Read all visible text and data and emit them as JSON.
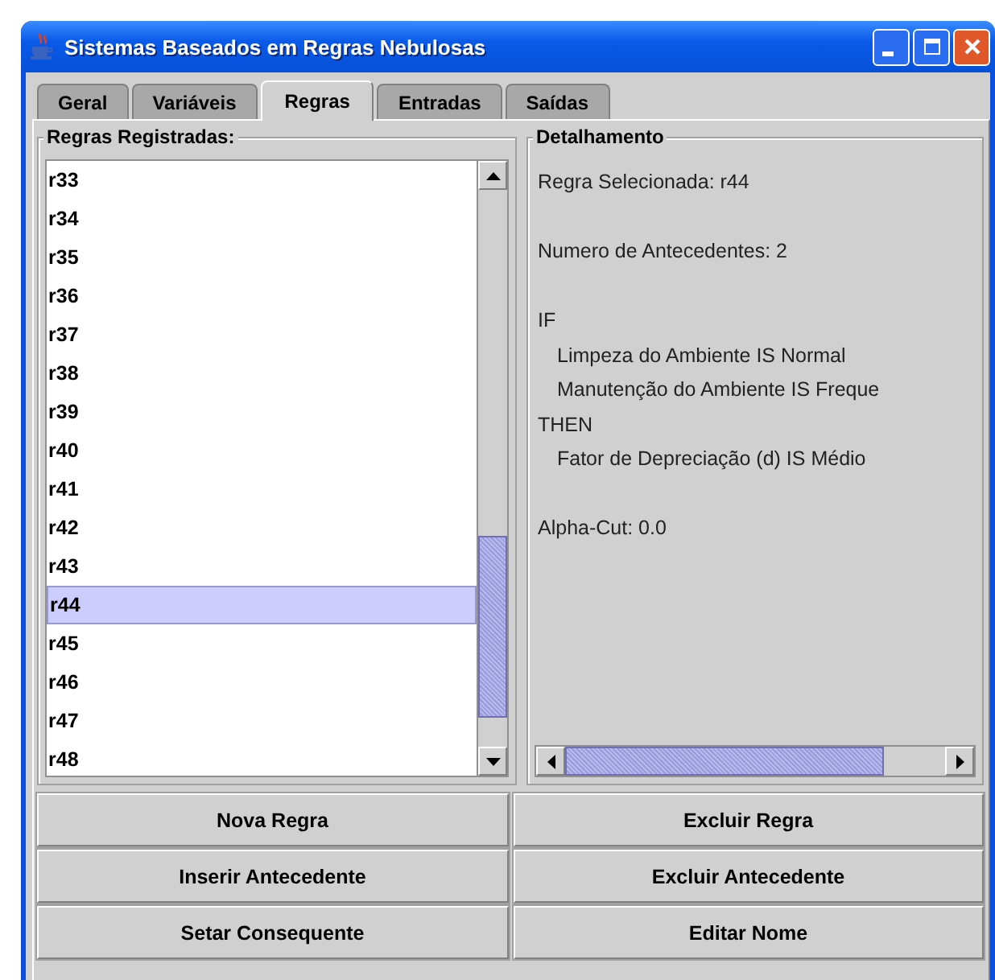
{
  "window": {
    "title": "Sistemas Baseados em Regras Nebulosas"
  },
  "tabs": [
    {
      "label": "Geral",
      "selected": false
    },
    {
      "label": "Variáveis",
      "selected": false
    },
    {
      "label": "Regras",
      "selected": true
    },
    {
      "label": "Entradas",
      "selected": false
    },
    {
      "label": "Saídas",
      "selected": false
    }
  ],
  "rules_panel": {
    "title": "Regras Registradas:",
    "items": [
      {
        "label": "r33",
        "selected": false
      },
      {
        "label": "r34",
        "selected": false
      },
      {
        "label": "r35",
        "selected": false
      },
      {
        "label": "r36",
        "selected": false
      },
      {
        "label": "r37",
        "selected": false
      },
      {
        "label": "r38",
        "selected": false
      },
      {
        "label": "r39",
        "selected": false
      },
      {
        "label": "r40",
        "selected": false
      },
      {
        "label": "r41",
        "selected": false
      },
      {
        "label": "r42",
        "selected": false
      },
      {
        "label": "r43",
        "selected": false
      },
      {
        "label": "r44",
        "selected": true
      },
      {
        "label": "r45",
        "selected": false
      },
      {
        "label": "r46",
        "selected": false
      },
      {
        "label": "r47",
        "selected": false
      },
      {
        "label": "r48",
        "selected": false
      }
    ]
  },
  "detail_panel": {
    "title": "Detalhamento",
    "selected_rule": "Regra Selecionada: r44",
    "antecedent_count": "Numero de Antecedentes: 2",
    "if_label": "IF",
    "antecedents": [
      "Limpeza do Ambiente IS Normal",
      "Manutenção do Ambiente IS Freque"
    ],
    "then_label": "THEN",
    "consequents": [
      "Fator de Depreciação (d) IS Médio"
    ],
    "alpha_cut": "Alpha-Cut: 0.0"
  },
  "buttons": [
    "Nova Regra",
    "Excluir Regra",
    "Inserir Antecedente",
    "Excluir Antecedente",
    "Setar Consequente",
    "Editar Nome"
  ]
}
